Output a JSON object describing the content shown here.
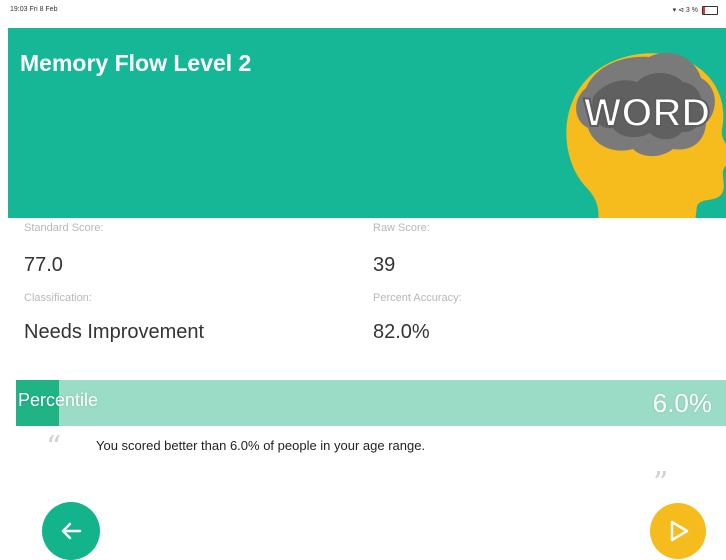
{
  "status_bar": {
    "time_date": "19:03  Fri 8 Feb",
    "indicators": "▾ ⊲ 3 %",
    "battery_color": "#e33333"
  },
  "header": {
    "title": "Memory Flow Level 2",
    "background": "#16b796",
    "logo_text": "WORD",
    "logo_icon": "head-brain-icon"
  },
  "scores": {
    "standard_label": "Standard Score:",
    "standard_value": "77.0",
    "raw_label": "Raw Score:",
    "raw_value": "39",
    "classification_label": "Classification:",
    "classification_value": "Needs Improvement",
    "accuracy_label": "Percent Accuracy:",
    "accuracy_value": "82.0%"
  },
  "percentile": {
    "label": "Percentile",
    "value": "6.0%",
    "fill_percent": 6.0,
    "track_color": "#9bdcc6",
    "fill_color": "#1fb386"
  },
  "feedback": {
    "text": "You scored better than 6.0% of people in your age range."
  },
  "navigation": {
    "back_icon": "arrow-left-icon",
    "next_icon": "play-triangle-icon",
    "back_color": "#13b48b",
    "next_color": "#f6bb1c"
  }
}
